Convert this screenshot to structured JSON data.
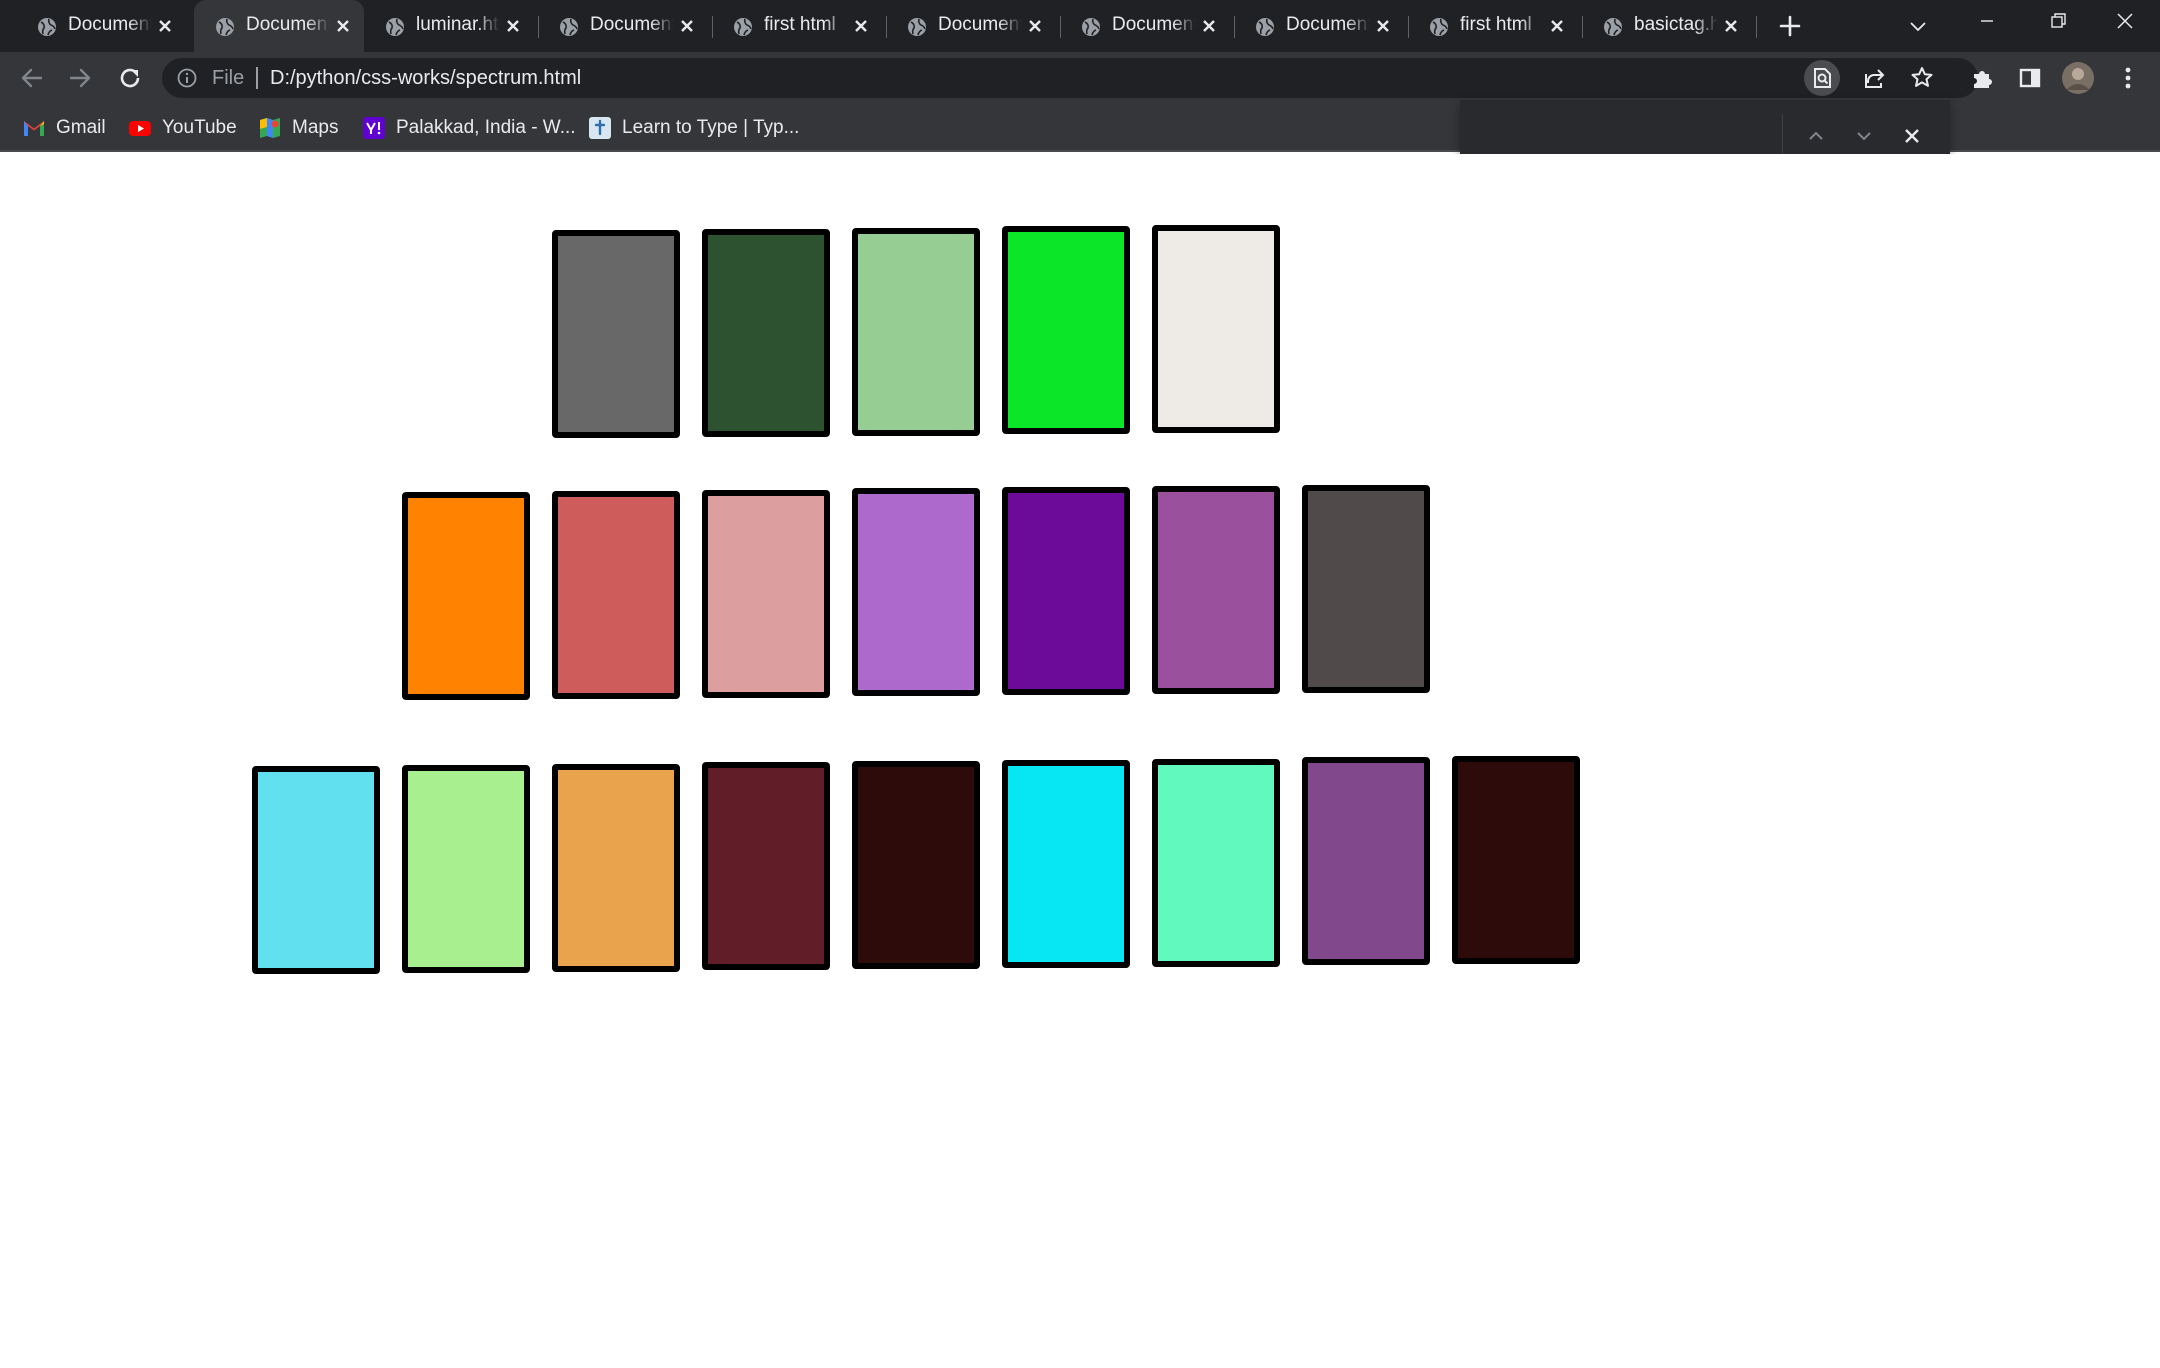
{
  "browser": {
    "tabs": [
      {
        "title": "Document"
      },
      {
        "title": "Document",
        "active": true
      },
      {
        "title": "luminar.html"
      },
      {
        "title": "Document"
      },
      {
        "title": "first html"
      },
      {
        "title": "Document"
      },
      {
        "title": "Document"
      },
      {
        "title": "Document"
      },
      {
        "title": "first html"
      },
      {
        "title": "basictag.html"
      }
    ],
    "address_bar": {
      "scheme_label": "File",
      "url": "D:/python/css-works/spectrum.html"
    },
    "bookmarks": [
      {
        "label": "Gmail",
        "icon": "gmail-icon"
      },
      {
        "label": "YouTube",
        "icon": "youtube-icon"
      },
      {
        "label": "Maps",
        "icon": "maps-icon"
      },
      {
        "label": "Palakkad, India - W...",
        "icon": "yahoo-icon"
      },
      {
        "label": "Learn to Type | Typ...",
        "icon": "typing-icon"
      }
    ],
    "find_bar": {
      "query": ""
    }
  },
  "colors": {
    "tab_strip": "#202124",
    "toolbar": "#35363a",
    "omnibox": "#202124",
    "text": "#e8eaed",
    "muted_text": "#9aa0a6"
  },
  "swatch_rows": [
    [
      "#686868",
      "#2d5230",
      "#95cd93",
      "#0ce628",
      "#eeeae5"
    ],
    [
      "#ff8200",
      "#cd5c5b",
      "#dc9e9e",
      "#ae69cc",
      "#6c0a99",
      "#9a509d",
      "#514a4a"
    ],
    [
      "#61e0ef",
      "#a7ef8f",
      "#e8a34c",
      "#611e28",
      "#2e0b0b",
      "#07e6f3",
      "#62f9bf",
      "#81488b",
      "#2e0b0b"
    ]
  ]
}
